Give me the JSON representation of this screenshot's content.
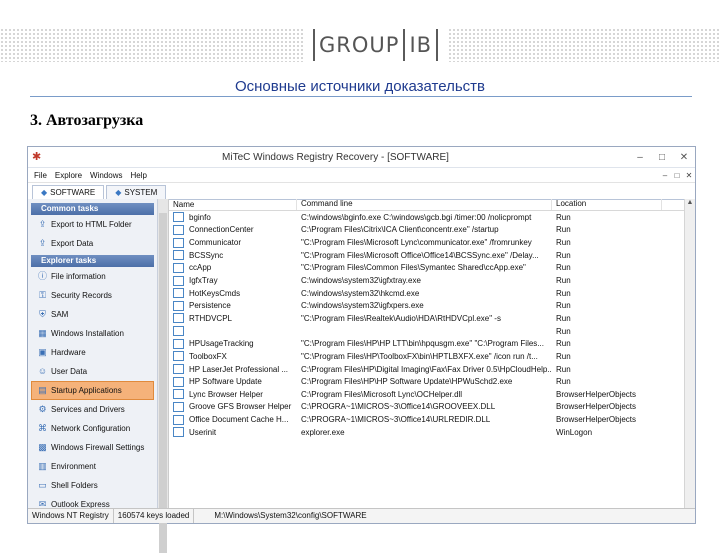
{
  "logo": {
    "left": "GROUP",
    "right": "IB"
  },
  "slide": {
    "title": "Основные источники доказательств",
    "heading": "3. Автозагрузка"
  },
  "window": {
    "title": "MiTeC Windows Registry Recovery - [SOFTWARE]",
    "minimize": "–",
    "maximize": "□",
    "close": "✕",
    "menu": [
      "File",
      "Explore",
      "Windows",
      "Help"
    ],
    "mdi": [
      "–",
      "□",
      "✕"
    ],
    "tabs": [
      "SOFTWARE",
      "SYSTEM"
    ]
  },
  "sidebar": {
    "groups": [
      {
        "title": "Common tasks",
        "items": [
          "Export to HTML Folder",
          "Export Data"
        ]
      },
      {
        "title": "Explorer tasks",
        "items": [
          "File information",
          "Security Records",
          "SAM",
          "Windows Installation",
          "Hardware",
          "User Data",
          "Startup Applications",
          "Services and Drivers",
          "Network Configuration",
          "Windows Firewall Settings",
          "Environment",
          "Shell Folders",
          "Outlook Express"
        ]
      }
    ],
    "selected": "Startup Applications"
  },
  "table": {
    "columns": [
      "Name",
      "Command line",
      "Location"
    ],
    "rows": [
      [
        "bginfo",
        "C:\\windows\\bginfo.exe C:\\windows\\gcb.bgi /timer:00 /nolicprompt",
        "Run"
      ],
      [
        "ConnectionCenter",
        "C:\\Program Files\\Citrix\\ICA Client\\concentr.exe\" /startup",
        "Run"
      ],
      [
        "Communicator",
        "\"C:\\Program Files\\Microsoft Lync\\communicator.exe\" /fromrunkey",
        "Run"
      ],
      [
        "BCSSync",
        "\"C:\\Program Files\\Microsoft Office\\Office14\\BCSSync.exe\" /Delay...",
        "Run"
      ],
      [
        "ccApp",
        "\"C:\\Program Files\\Common Files\\Symantec Shared\\ccApp.exe\"",
        "Run"
      ],
      [
        "IgfxTray",
        "C:\\windows\\system32\\igfxtray.exe",
        "Run"
      ],
      [
        "HotKeysCmds",
        "C:\\windows\\system32\\hkcmd.exe",
        "Run"
      ],
      [
        "Persistence",
        "C:\\windows\\system32\\igfxpers.exe",
        "Run"
      ],
      [
        "RTHDVCPL",
        "\"C:\\Program Files\\Realtek\\Audio\\HDA\\RtHDVCpl.exe\" -s",
        "Run"
      ],
      [
        "",
        "",
        "Run"
      ],
      [
        "HPUsageTracking",
        "\"C:\\Program Files\\HP\\HP LTT\\bin\\hpqusgm.exe\" \"C:\\Program Files...",
        "Run"
      ],
      [
        "ToolboxFX",
        "\"C:\\Program Files\\HP\\ToolboxFX\\bin\\HPTLBXFX.exe\" /icon run /t...",
        "Run"
      ],
      [
        "HP LaserJet Professional ...",
        "C:\\Program Files\\HP\\Digital Imaging\\Fax\\Fax Driver 0.5\\HpCloudHelp...",
        "Run"
      ],
      [
        "HP Software Update",
        "C:\\Program Files\\HP\\HP Software Update\\HPWuSchd2.exe",
        "Run"
      ],
      [
        "Lync Browser Helper",
        "C:\\Program Files\\Microsoft Lync\\OCHelper.dll",
        "BrowserHelperObjects"
      ],
      [
        "Groove GFS Browser Helper",
        "C:\\PROGRA~1\\MICROS~3\\Office14\\GROOVEEX.DLL",
        "BrowserHelperObjects"
      ],
      [
        "Office Document Cache H...",
        "C:\\PROGRA~1\\MICROS~3\\Office14\\URLREDIR.DLL",
        "BrowserHelperObjects"
      ],
      [
        "Userinit",
        "explorer.exe",
        "WinLogon"
      ]
    ]
  },
  "status": {
    "type": "Windows NT Registry",
    "keys": "160574 keys loaded",
    "path": "M:\\Windows\\System32\\config\\SOFTWARE"
  },
  "icons": {
    "app": "app-bug-icon",
    "tab": "hive-icon",
    "row": "window-icon"
  }
}
